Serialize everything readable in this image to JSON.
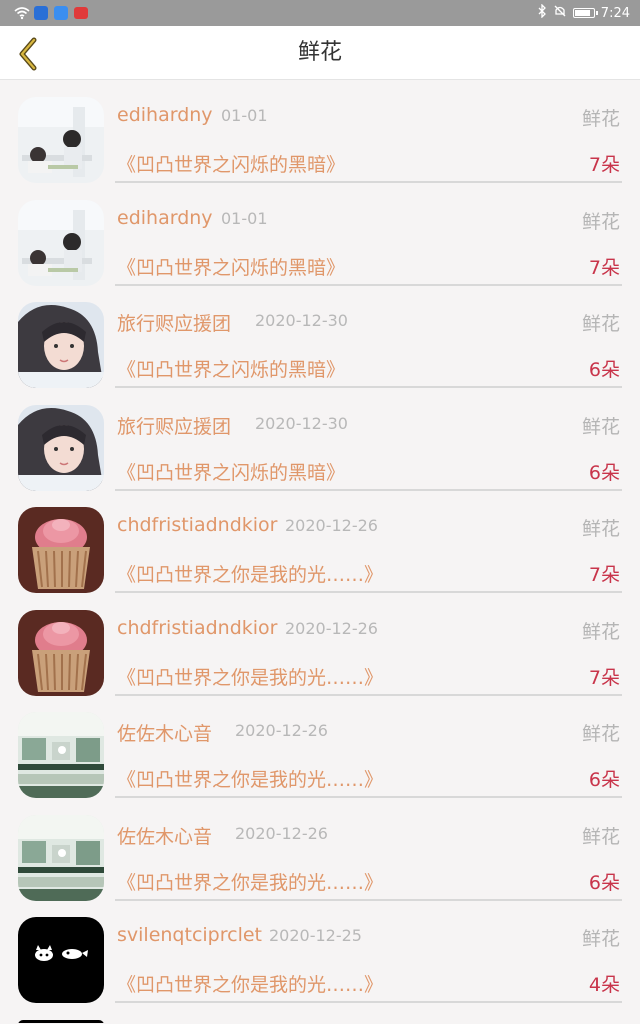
{
  "status_bar": {
    "time": "7:24",
    "icons": [
      "wifi-icon",
      "app-icon",
      "app-icon",
      "app-icon",
      "bluetooth-icon",
      "mute-icon",
      "battery-icon"
    ]
  },
  "header": {
    "title": "鲜花",
    "back_icon": "chevron-left-icon"
  },
  "colors": {
    "accent": "#e0976a",
    "count": "#c8344a",
    "muted": "#b5b5b5"
  },
  "records": [
    {
      "user": "edihardny",
      "date": "01-01",
      "type": "鲜花",
      "book": "《凹凸世界之闪烁的黑暗》",
      "count": "7朵",
      "avatar": "classroom"
    },
    {
      "user": "edihardny",
      "date": "01-01",
      "type": "鲜花",
      "book": "《凹凸世界之闪烁的黑暗》",
      "count": "7朵",
      "avatar": "classroom"
    },
    {
      "user": "旅行赆应援团",
      "date": "2020-12-30",
      "type": "鲜花",
      "book": "《凹凸世界之闪烁的黑暗》",
      "count": "6朵",
      "avatar": "girl"
    },
    {
      "user": "旅行赆应援团",
      "date": "2020-12-30",
      "type": "鲜花",
      "book": "《凹凸世界之闪烁的黑暗》",
      "count": "6朵",
      "avatar": "girl"
    },
    {
      "user": "chdfristiadndkior",
      "date": "2020-12-26",
      "type": "鲜花",
      "book": "《凹凸世界之你是我的光……》",
      "count": "7朵",
      "avatar": "cupcake"
    },
    {
      "user": "chdfristiadndkior",
      "date": "2020-12-26",
      "type": "鲜花",
      "book": "《凹凸世界之你是我的光……》",
      "count": "7朵",
      "avatar": "cupcake"
    },
    {
      "user": "佐佐木心音",
      "date": "2020-12-26",
      "type": "鲜花",
      "book": "《凹凸世界之你是我的光……》",
      "count": "6朵",
      "avatar": "scene"
    },
    {
      "user": "佐佐木心音",
      "date": "2020-12-26",
      "type": "鲜花",
      "book": "《凹凸世界之你是我的光……》",
      "count": "6朵",
      "avatar": "scene"
    },
    {
      "user": "svilenqtciprclet",
      "date": "2020-12-25",
      "type": "鲜花",
      "book": "《凹凸世界之你是我的光……》",
      "count": "4朵",
      "avatar": "dark"
    }
  ]
}
